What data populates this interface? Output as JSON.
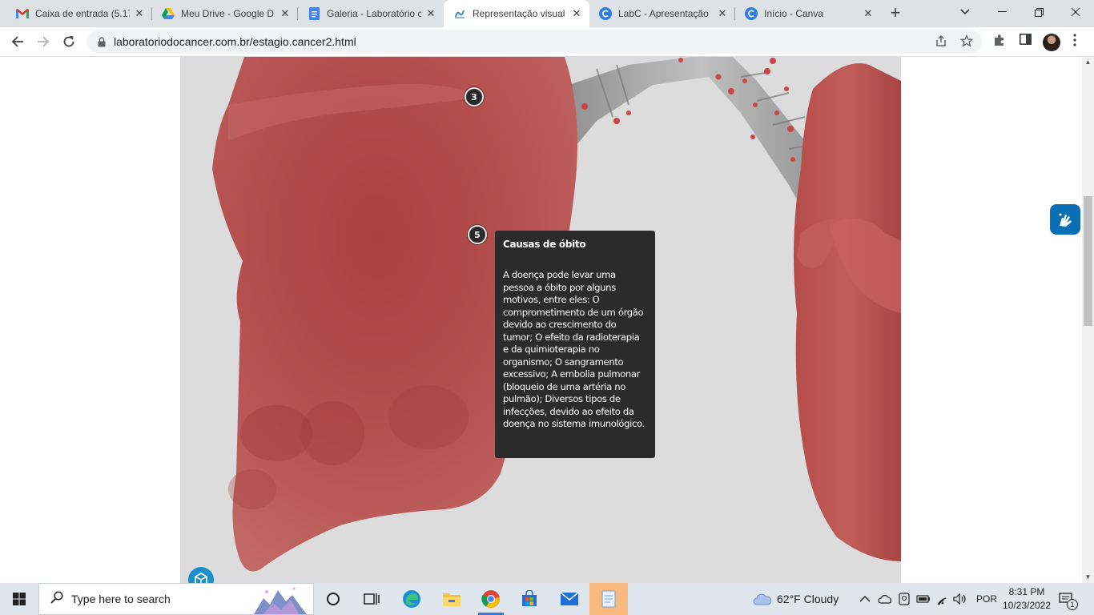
{
  "tabs": [
    {
      "title": "Caixa de entrada (5.17",
      "icon": "gmail-icon",
      "active": false
    },
    {
      "title": "Meu Drive - Google D",
      "icon": "google-drive-icon",
      "active": false
    },
    {
      "title": "Galeria - Laboratório c",
      "icon": "google-docs-icon",
      "active": false
    },
    {
      "title": "Representação visual c",
      "icon": "labc-site-icon",
      "active": true
    },
    {
      "title": "LabC - Apresentação",
      "icon": "canva-icon",
      "active": false
    },
    {
      "title": "Início - Canva",
      "icon": "canva-icon",
      "active": false
    }
  ],
  "toolbar": {
    "url": "laboratoriodocancer.com.br/estagio.cancer2.html"
  },
  "viewer": {
    "hotspots": [
      {
        "number": "3"
      },
      {
        "number": "5"
      }
    ],
    "annotation": {
      "title": "Causas de óbito",
      "body": "A doença pode levar uma pessoa a óbito por alguns motivos, entre eles: O comprometimento de um órgão devido ao crescimento do tumor; O efeito da radioterapia e da quimioterapia no organismo; O sangramento excessivo; A embolia pulmonar (bloqueio de uma artéria no pulmão); Diversos tipos de infecções, devido ao efeito da doença no sistema imunológico."
    }
  },
  "taskbar": {
    "search_placeholder": "Type here to search",
    "weather": "62°F  Cloudy",
    "language": "POR",
    "time": "8:31 PM",
    "date": "10/23/2022",
    "notification_count": "1"
  },
  "colors": {
    "lung": "#b8524f",
    "trachea": "#a9a9a9",
    "annotation_bg": "#2b2b2b",
    "vlibras": "#0a6fb4"
  }
}
